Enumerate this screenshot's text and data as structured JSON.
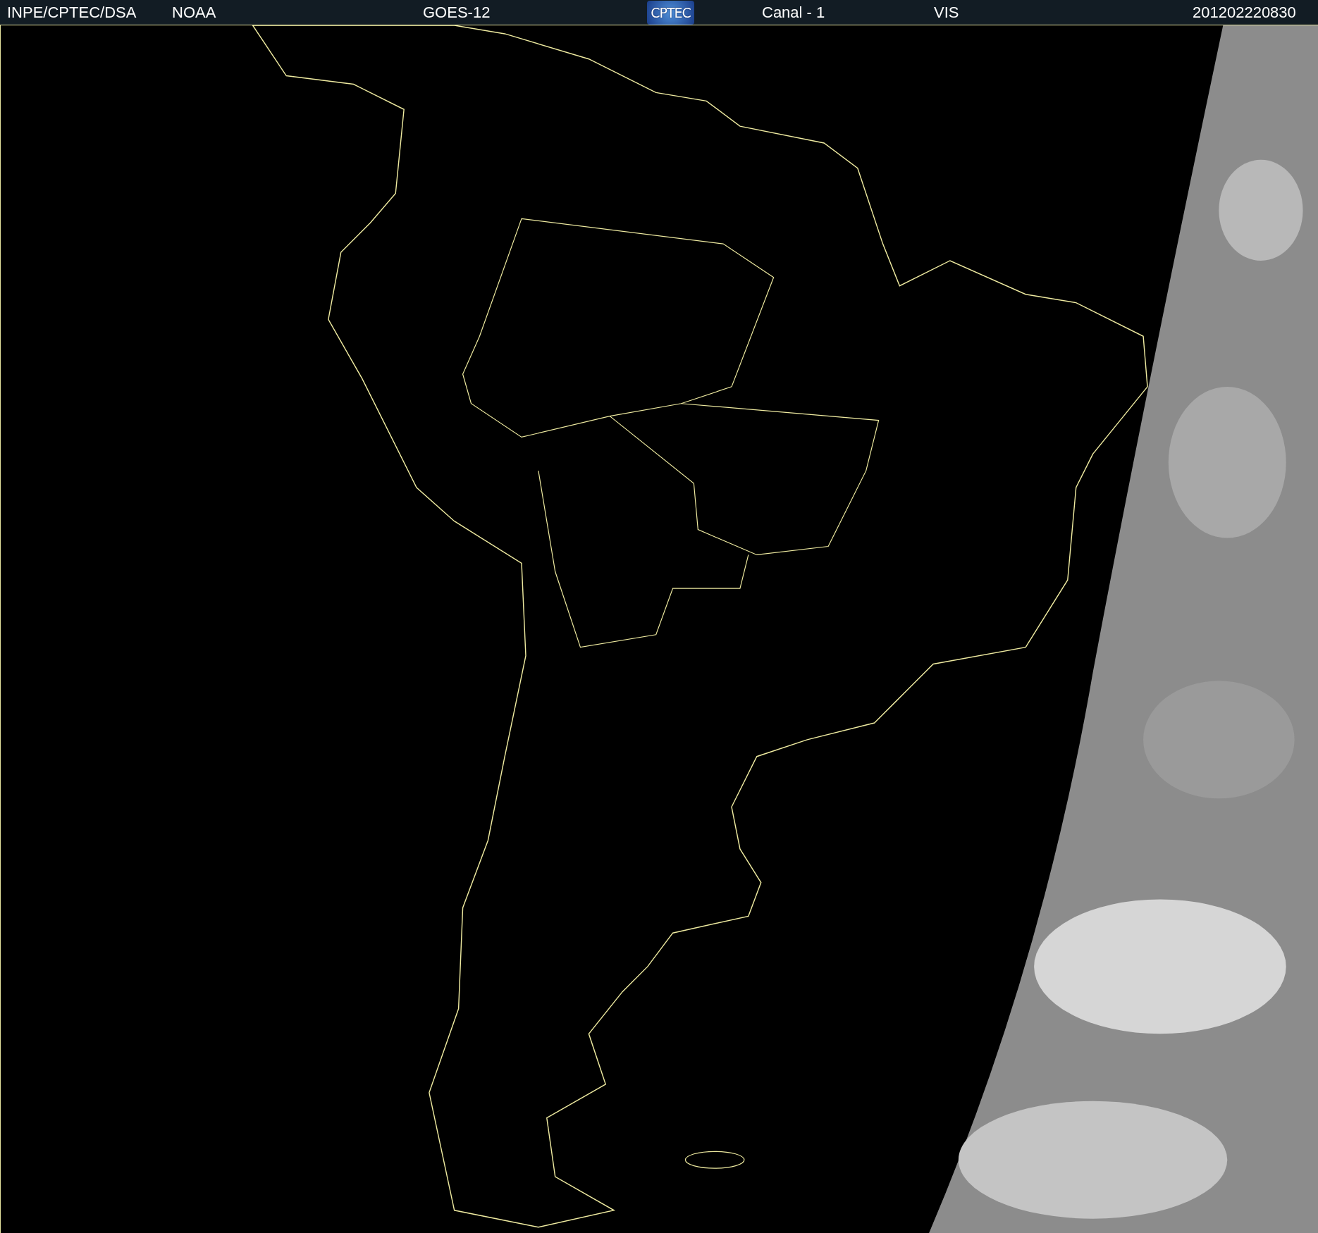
{
  "header": {
    "source": "INPE/CPTEC/DSA",
    "agency": "NOAA",
    "satellite": "GOES-12",
    "logo_text": "CPTEC",
    "channel": "Canal - 1",
    "band": "VIS",
    "timestamp": "201202220830"
  }
}
